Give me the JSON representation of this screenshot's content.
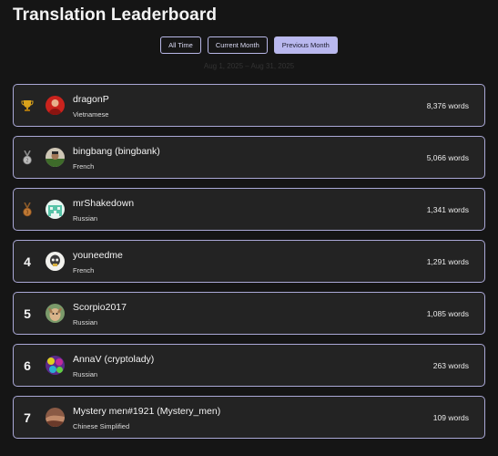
{
  "title": "Translation Leaderboard",
  "filters": [
    {
      "label": "All Time",
      "active": false
    },
    {
      "label": "Current Month",
      "active": false
    },
    {
      "label": "Previous Month",
      "active": true
    }
  ],
  "date_range": "Aug 1, 2025 – Aug 31, 2025",
  "colors": {
    "background": "#151515",
    "card": "#232323",
    "card_border": "#aaa8d6",
    "accent": "#b9b8ef"
  },
  "entries": [
    {
      "rank_icon": "trophy-icon",
      "rank": "",
      "name": "dragonP",
      "language": "Vietnamese",
      "words": "8,376 words",
      "avatar": "avatar-red"
    },
    {
      "rank_icon": "silver-medal-icon",
      "rank": "",
      "name": "bingbang (bingbank)",
      "language": "French",
      "words": "5,066 words",
      "avatar": "avatar-photo"
    },
    {
      "rank_icon": "bronze-medal-icon",
      "rank": "",
      "name": "mrShakedown",
      "language": "Russian",
      "words": "1,341 words",
      "avatar": "avatar-teal"
    },
    {
      "rank_icon": "",
      "rank": "4",
      "name": "youneedme",
      "language": "French",
      "words": "1,291 words",
      "avatar": "avatar-skull"
    },
    {
      "rank_icon": "",
      "rank": "5",
      "name": "Scorpio2017",
      "language": "Russian",
      "words": "1,085 words",
      "avatar": "avatar-dog"
    },
    {
      "rank_icon": "",
      "rank": "6",
      "name": "AnnaV (cryptolady)",
      "language": "Russian",
      "words": "263 words",
      "avatar": "avatar-pattern"
    },
    {
      "rank_icon": "",
      "rank": "7",
      "name": "Mystery men#1921 (Mystery_men)",
      "language": "Chinese Simplified",
      "words": "109 words",
      "avatar": "avatar-brown"
    }
  ]
}
